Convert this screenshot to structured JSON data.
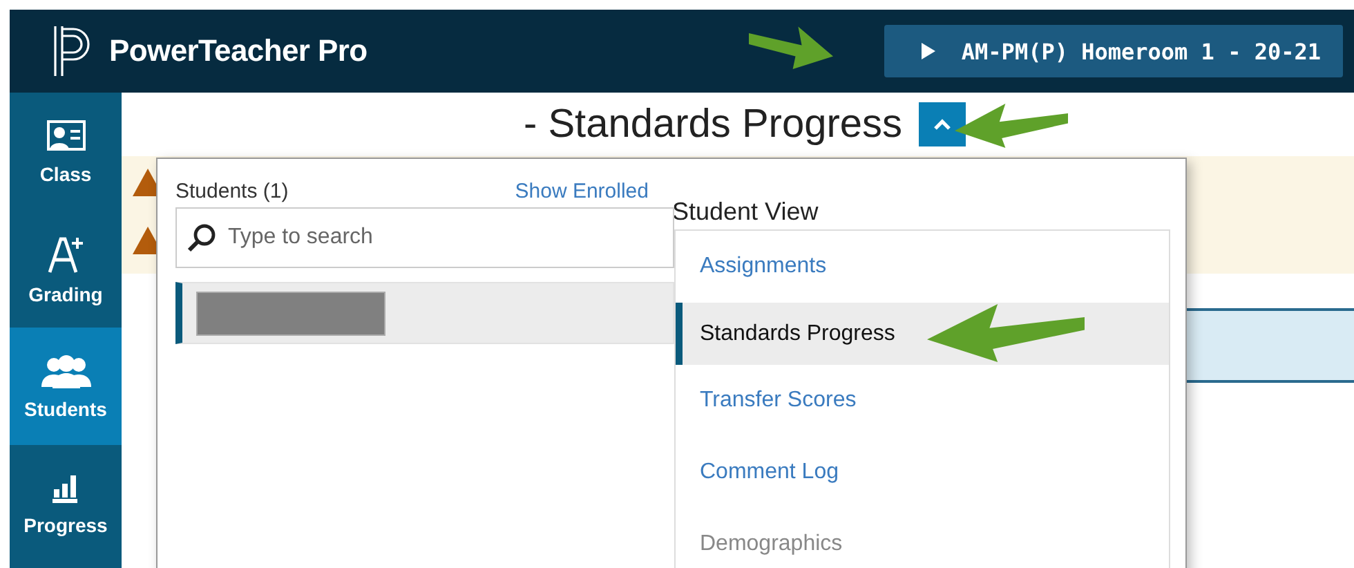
{
  "header": {
    "app_name": "PowerTeacher Pro",
    "class_selector": "AM-PM(P) Homeroom 1 - 20-21"
  },
  "nav": [
    {
      "label": "Class",
      "selected": false
    },
    {
      "label": "Grading",
      "selected": false
    },
    {
      "label": "Students",
      "selected": true
    },
    {
      "label": "Progress",
      "selected": false
    }
  ],
  "page_title": {
    "text": "- Standards Progress",
    "expanded": true
  },
  "banners": [
    {
      "kind": "warning"
    },
    {
      "kind": "warning"
    }
  ],
  "student_panel": {
    "heading": "Students (1)",
    "link": "Show Enrolled",
    "search": {
      "placeholder": "Type to search"
    },
    "students": [
      {
        "selected": true
      }
    ]
  },
  "view_panel": {
    "heading": "Student View",
    "items": [
      {
        "label": "Assignments",
        "selected": false,
        "disabled": false
      },
      {
        "label": "Standards Progress",
        "selected": true,
        "disabled": false
      },
      {
        "label": "Transfer Scores",
        "selected": false,
        "disabled": false
      },
      {
        "label": "Comment Log",
        "selected": false,
        "disabled": false
      },
      {
        "label": "Demographics",
        "selected": false,
        "disabled": true
      }
    ]
  }
}
